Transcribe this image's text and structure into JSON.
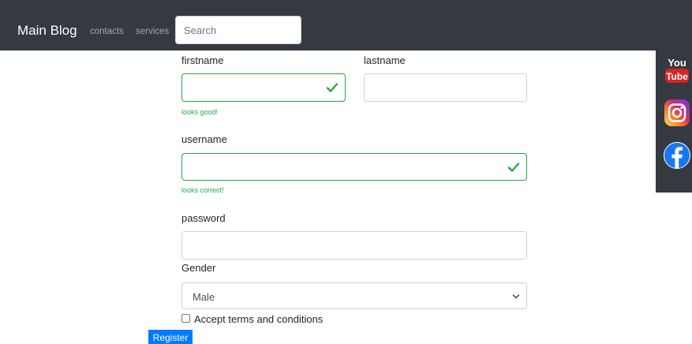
{
  "navbar": {
    "brand": "Main Blog",
    "links": [
      "contacts",
      "services"
    ],
    "search_placeholder": "Search"
  },
  "social": {
    "items": [
      "youtube-icon",
      "instagram-icon",
      "facebook-icon"
    ],
    "youtube_text": [
      "You",
      "Tube"
    ]
  },
  "form": {
    "firstname_label": "firstname",
    "lastname_label": "lastname",
    "firstname_feedback": "looks good!",
    "username_label": "username",
    "username_feedback": "looks correct!",
    "password_label": "password",
    "gender_label": "Gender",
    "gender_value": "Male",
    "terms_label": "Accept terms and conditions",
    "register_label": "Register"
  },
  "colors": {
    "navbar": "#343a40",
    "valid": "#28a745",
    "primary": "#007bff"
  }
}
